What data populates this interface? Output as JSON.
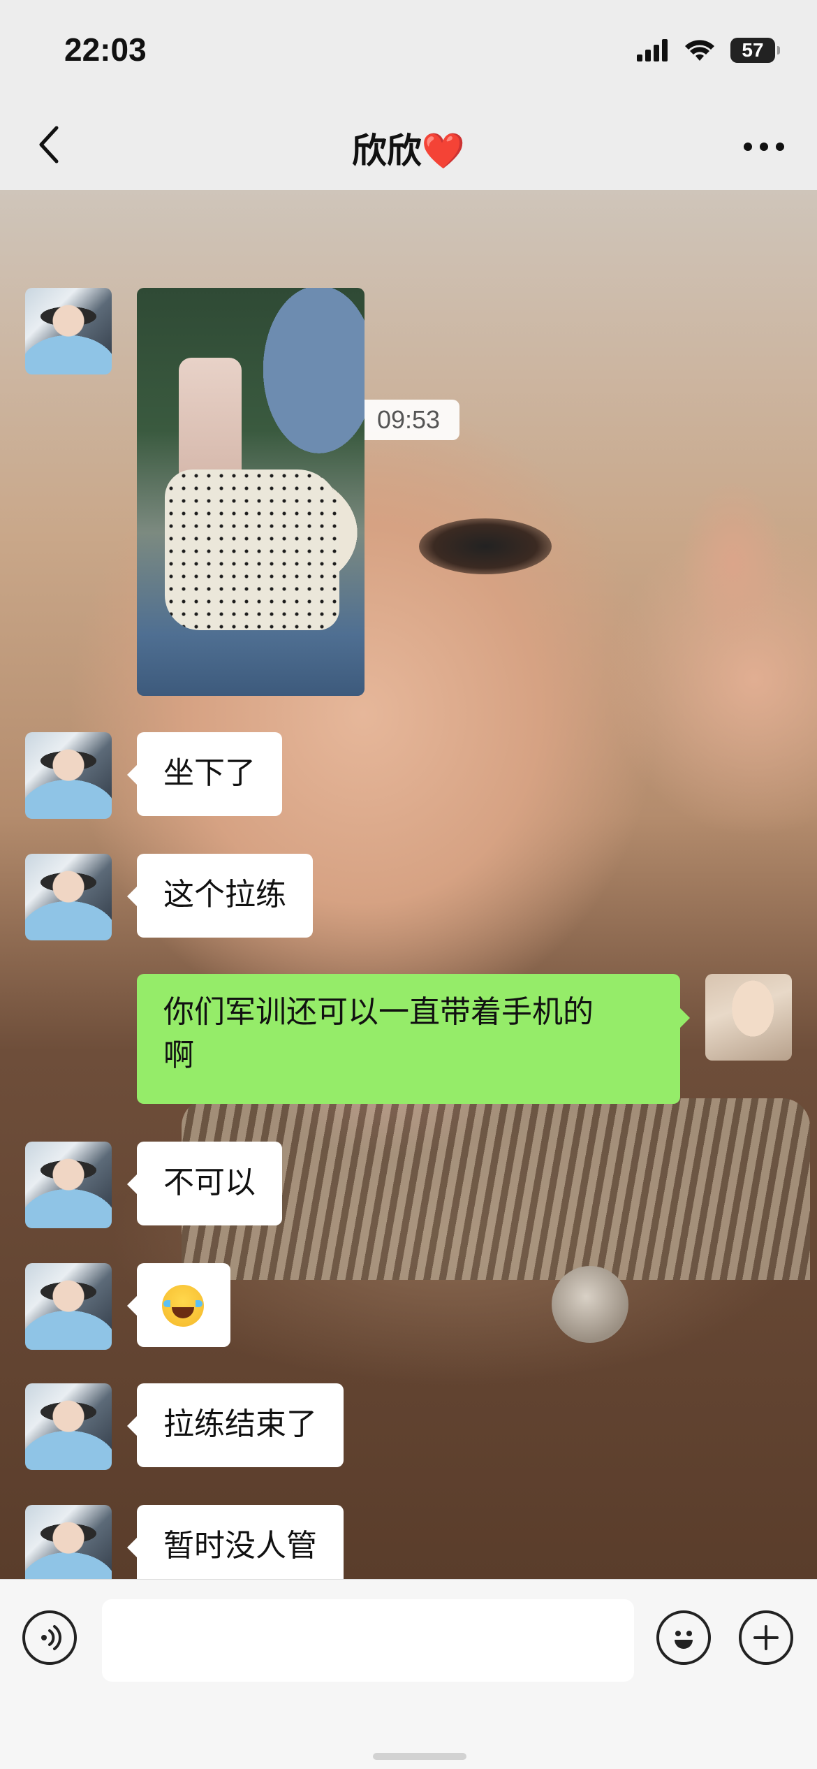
{
  "status_bar": {
    "time": "22:03",
    "battery_level": "57",
    "signal_icon": "cellular-signal-icon",
    "wifi_icon": "wifi-icon"
  },
  "nav": {
    "title": "欣欣❤️",
    "back_icon": "chevron-left-icon",
    "more_icon": "more-dots-icon"
  },
  "chat": {
    "timestamp": "09:53",
    "messages": [
      {
        "from": "other",
        "type": "image",
        "description_icon": "photo-message"
      },
      {
        "from": "other",
        "type": "text",
        "text": "坐下了"
      },
      {
        "from": "other",
        "type": "text",
        "text": "这个拉练"
      },
      {
        "from": "self",
        "type": "text",
        "line1": "你们军训还可以一直带着手机的",
        "line2": "啊"
      },
      {
        "from": "other",
        "type": "text",
        "text": "不可以"
      },
      {
        "from": "other",
        "type": "emoji",
        "emoji_name": "face-with-tears-of-joy"
      },
      {
        "from": "other",
        "type": "text",
        "text": "拉练结束了"
      },
      {
        "from": "other",
        "type": "text",
        "text": "暂时没人管"
      }
    ]
  },
  "input_bar": {
    "voice_icon": "voice-input-icon",
    "text_value": "",
    "emoji_icon": "emoji-icon",
    "plus_icon": "plus-icon"
  },
  "colors": {
    "self_bubble": "#95ec69",
    "other_bubble": "#ffffff",
    "bar_bg": "#ededed"
  }
}
